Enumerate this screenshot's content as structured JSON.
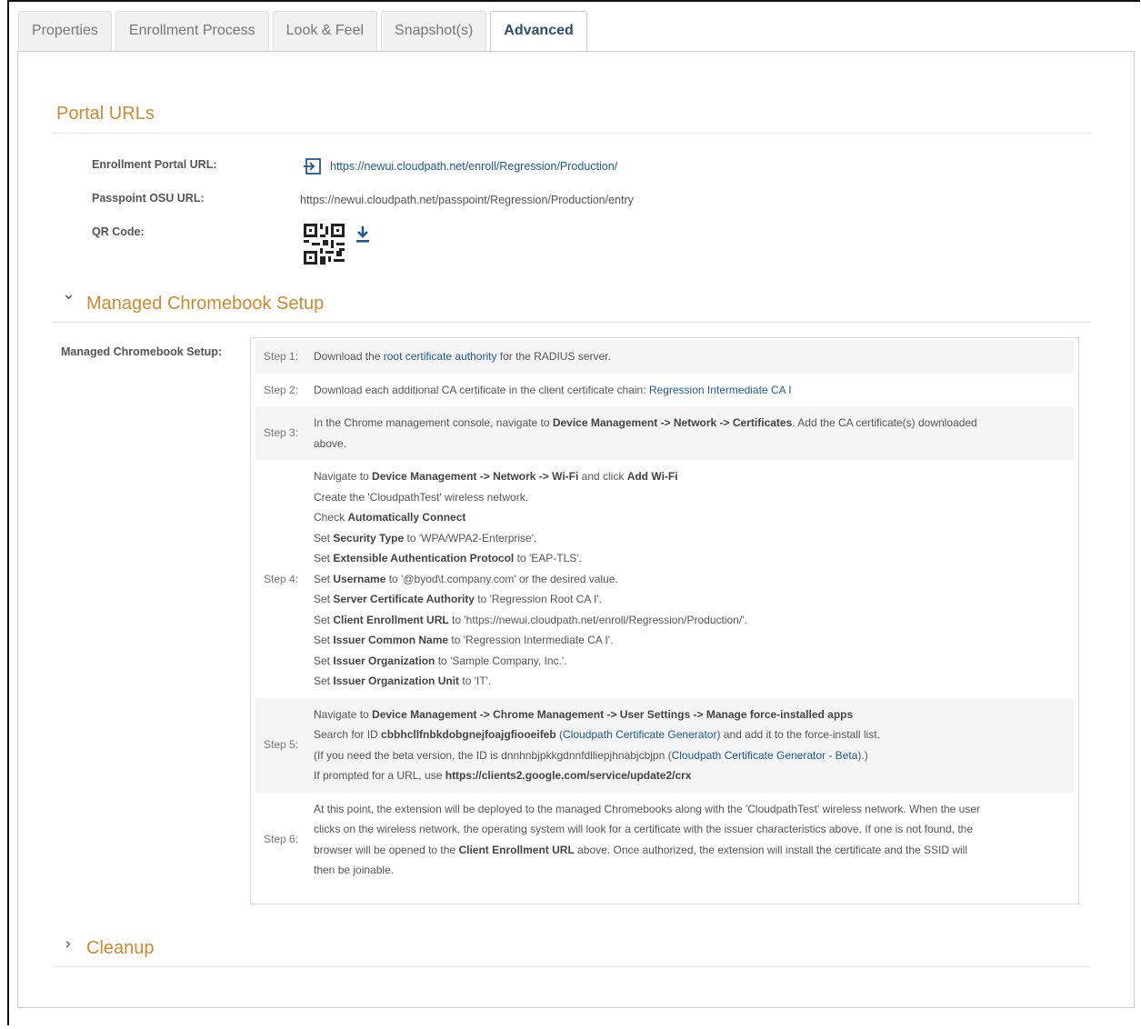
{
  "tabs": [
    "Properties",
    "Enrollment Process",
    "Look & Feel",
    "Snapshot(s)",
    "Advanced"
  ],
  "active_tab": "Advanced",
  "portal_urls": {
    "title": "Portal URLs",
    "enrollment_label": "Enrollment Portal URL:",
    "enrollment_url": "https://newui.cloudpath.net/enroll/Regression/Production/",
    "passpoint_label": "Passpoint OSU URL:",
    "passpoint_url": "https://newui.cloudpath.net/passpoint/Regression/Production/entry",
    "qr_label": "QR Code:"
  },
  "chromebook": {
    "title": "Managed Chromebook Setup",
    "label": "Managed Chromebook Setup:",
    "steps": [
      {
        "num": "Step 1:"
      },
      {
        "num": "Step 2:"
      },
      {
        "num": "Step 3:"
      },
      {
        "num": "Step 4:"
      },
      {
        "num": "Step 5:"
      },
      {
        "num": "Step 6:"
      }
    ],
    "s1": {
      "a": "Download the ",
      "link": "root certificate authority",
      "b": " for the RADIUS server."
    },
    "s2": {
      "a": "Download each additional CA certificate in the client certificate chain: ",
      "link": "Regression Intermediate CA I"
    },
    "s3": {
      "a": "In the Chrome management console, navigate to ",
      "b1": "Device Management -> Network -> Certificates",
      "c": ". Add the CA certificate(s) downloaded",
      "d": "above."
    },
    "s4": {
      "l1a": "Navigate to ",
      "l1b": "Device Management -> Network -> Wi-Fi",
      "l1c": " and click ",
      "l1d": "Add Wi-Fi",
      "l2": "Create the 'CloudpathTest' wireless network.",
      "l3a": "Check ",
      "l3b": "Automatically Connect",
      "l4a": "Set ",
      "l4b": "Security Type",
      "l4c": " to 'WPA/WPA2-Enterprise'.",
      "l5a": "Set ",
      "l5b": "Extensible Authentication Protocol",
      "l5c": " to 'EAP-TLS'.",
      "l6a": "Set ",
      "l6b": "Username",
      "l6c": " to '@byod\\t.company.com' or the desired value.",
      "l7a": "Set ",
      "l7b": "Server Certificate Authority",
      "l7c": " to 'Regression Root CA I'.",
      "l8a": "Set ",
      "l8b": "Client Enrollment URL",
      "l8c": " to 'https://newui.cloudpath.net/enroll/Regression/Production/'.",
      "l9a": "Set ",
      "l9b": "Issuer Common Name",
      "l9c": " to 'Regression Intermediate CA I'.",
      "l10a": "Set ",
      "l10b": "Issuer Organization",
      "l10c": " to 'Sample Company, Inc.'.",
      "l11a": "Set ",
      "l11b": "Issuer Organization Unit",
      "l11c": " to 'IT'."
    },
    "s5": {
      "l1a": "Navigate to ",
      "l1b": "Device Management -> Chrome Management -> User Settings -> Manage force-installed apps",
      "l2a": "Search for ID ",
      "l2b": "cbbhcllfnbkdobgnejfoajgfiooeifeb",
      "l2c": " (",
      "l2link": "Cloudpath Certificate Generator",
      "l2d": ") and add it to the force-install list.",
      "l3a": "(If you need the beta version, the ID is dnnhnbjpkkgdnnfdlliepjhnabjcbjpn (",
      "l3link": "Cloudpath Certificate Generator - Beta",
      "l3b": ").)",
      "l4a": "If prompted for a URL, use ",
      "l4b": "https://clients2.google.com/service/update2/crx"
    },
    "s6": {
      "l1": "At this point, the extension will be deployed to the managed Chromebooks along with the 'CloudpathTest' wireless network. When the user",
      "l2": "clicks on the wireless network, the operating system will look for a certificate with the issuer characteristics above. If one is not found, the",
      "l3a": "browser will be opened to the ",
      "l3b": "Client Enrollment URL",
      "l3c": " above. Once authorized, the extension will install the certificate and the SSID will",
      "l4": "then be joinable."
    }
  },
  "cleanup": {
    "title": "Cleanup"
  },
  "colors": {
    "section_title": "#cf8a2e",
    "link": "#1d5a93",
    "active_tab": "#2e4e6f"
  }
}
